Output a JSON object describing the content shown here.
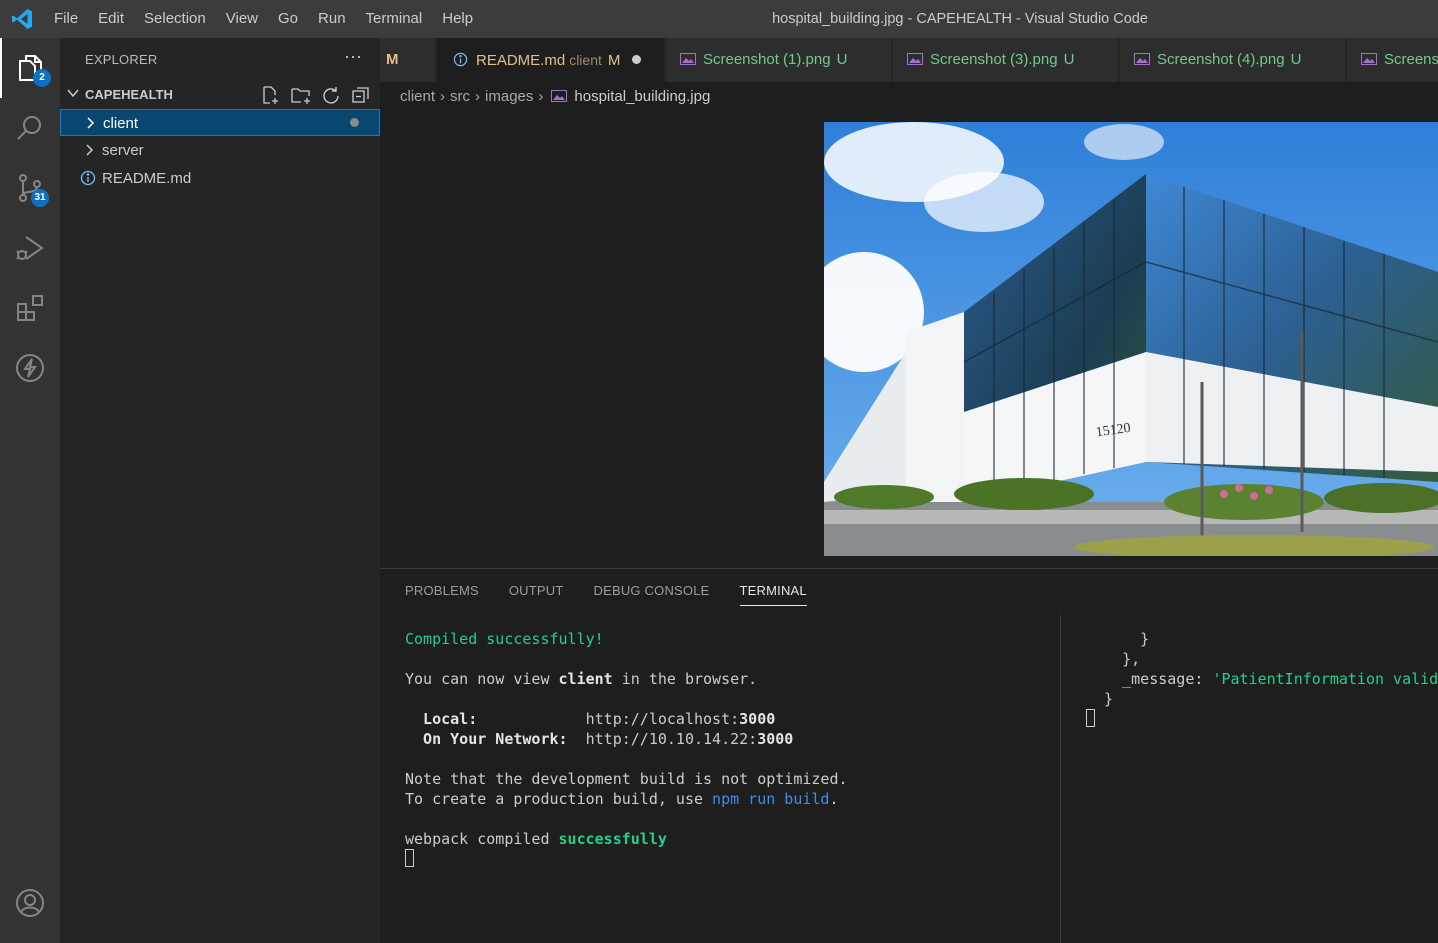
{
  "titlebar": {
    "menu": [
      "File",
      "Edit",
      "Selection",
      "View",
      "Go",
      "Run",
      "Terminal",
      "Help"
    ],
    "window_title": "hospital_building.jpg - CAPEHEALTH - Visual Studio Code"
  },
  "activity_bar": {
    "explorer_badge": "2",
    "scm_badge": "31"
  },
  "sidebar": {
    "title": "EXPLORER",
    "more": "···",
    "section": "CAPEHEALTH",
    "items": [
      {
        "label": "client",
        "type": "folder",
        "selected": true
      },
      {
        "label": "server",
        "type": "folder"
      },
      {
        "label": "README.md",
        "type": "file"
      }
    ]
  },
  "tabs": {
    "partial_flag": "M",
    "readme": {
      "name": "README.md",
      "dir": "client",
      "flag": "M"
    },
    "screenshots": [
      {
        "name": "Screenshot (1).png",
        "flag": "U"
      },
      {
        "name": "Screenshot (3).png",
        "flag": "U"
      },
      {
        "name": "Screenshot (4).png",
        "flag": "U"
      },
      {
        "name": "Screens"
      }
    ]
  },
  "breadcrumb": {
    "parts": [
      "client",
      "src",
      "images"
    ],
    "file": "hospital_building.jpg"
  },
  "image": {
    "building_number": "15120"
  },
  "panel": {
    "tabs": [
      "PROBLEMS",
      "OUTPUT",
      "DEBUG CONSOLE",
      "TERMINAL"
    ],
    "active_tab": "TERMINAL",
    "terminal_left": {
      "compiled": "Compiled successfully!",
      "view_pre": "You can now view ",
      "view_app": "client",
      "view_post": " in the browser.",
      "local_label": "  Local:",
      "local_url_pre": "http://localhost:",
      "local_port": "3000",
      "network_label": "  On Your Network:",
      "network_url_pre": "http://10.10.14.22:",
      "network_port": "3000",
      "note1": "Note that the development build is not optimized.",
      "note2_pre": "To create a production build, use ",
      "note2_cmd": "npm run build",
      "note2_post": ".",
      "webpack_pre": "webpack compiled ",
      "webpack_status": "successfully"
    },
    "terminal_right": {
      "line1": "      }",
      "line2": "    },",
      "line3_pre": "    _message: ",
      "line3_str": "'PatientInformation validat",
      "line4": "  }"
    }
  },
  "colors": {
    "accent": "#007fd4",
    "badge": "#0e70c0",
    "untracked": "#73c991",
    "modified": "#e2c08d",
    "terminal_green": "#23d18b",
    "terminal_blue": "#3b8eea"
  }
}
